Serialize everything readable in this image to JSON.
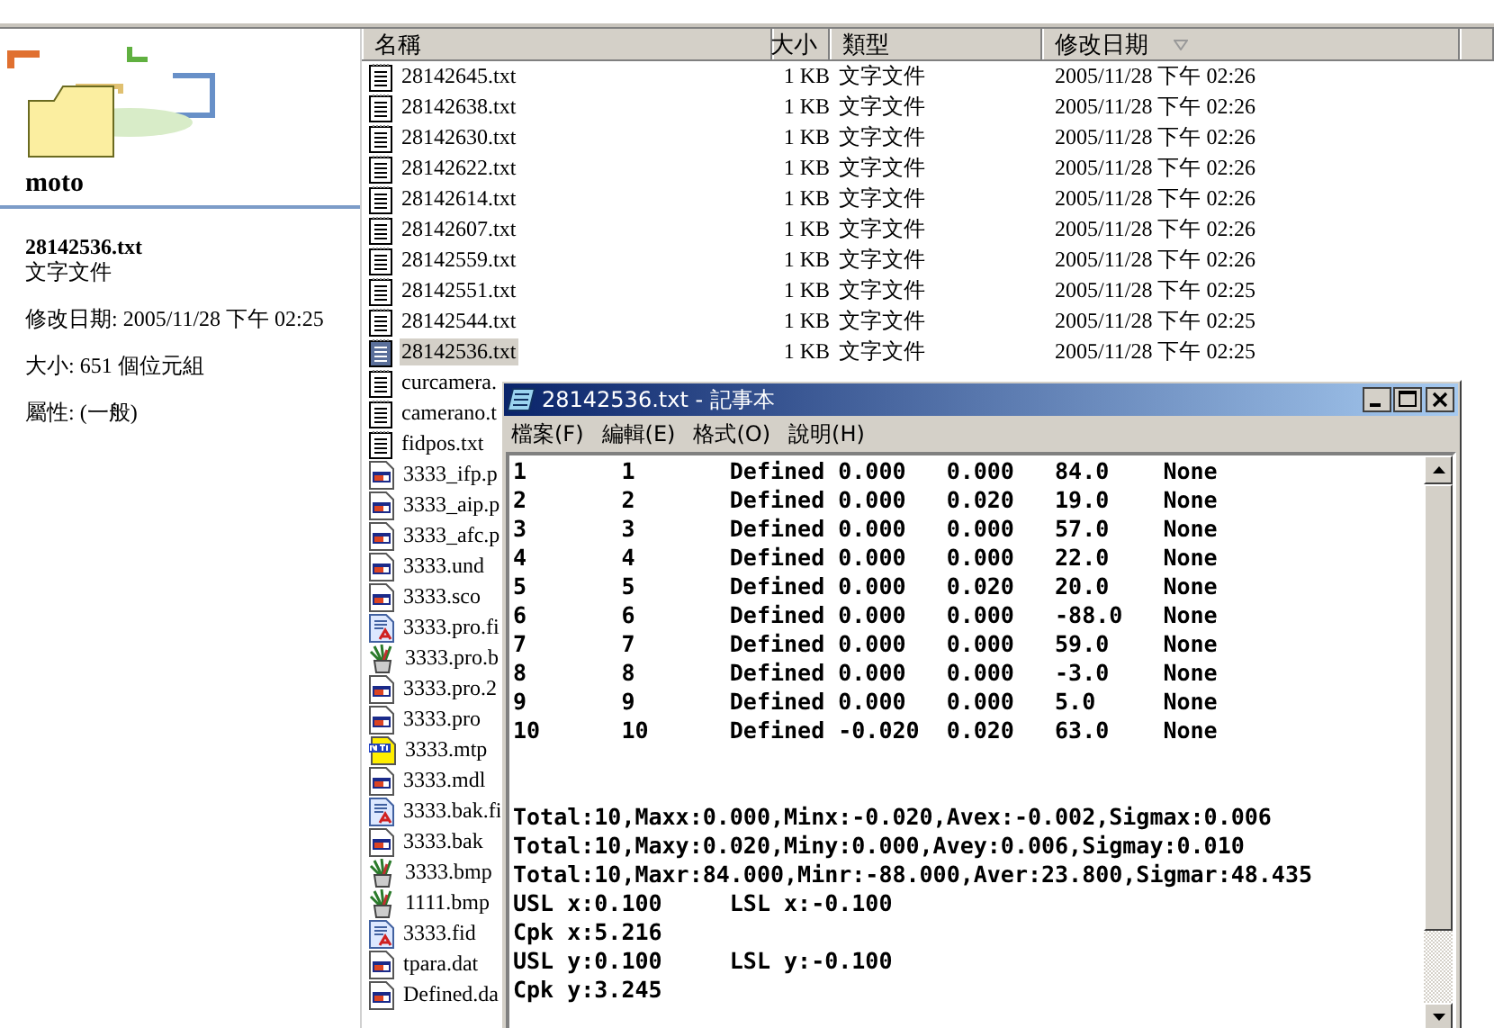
{
  "details_panel": {
    "folder_name": "moto",
    "file_name": "28142536.txt",
    "file_type": "文字文件",
    "modified": "修改日期: 2005/11/28 下午 02:25",
    "size": "大小: 651 個位元組",
    "attributes": "屬性: (一般)"
  },
  "file_list": {
    "columns": [
      {
        "label": "名稱",
        "sorted": false
      },
      {
        "label": "大小",
        "sorted": false
      },
      {
        "label": "類型",
        "sorted": false
      },
      {
        "label": "修改日期",
        "sorted": true
      }
    ],
    "rows": [
      {
        "kind": "text",
        "name": "28142645.txt",
        "size": "1 KB",
        "type": "文字文件",
        "modified": "2005/11/28 下午 02:26",
        "selected": false
      },
      {
        "kind": "text",
        "name": "28142638.txt",
        "size": "1 KB",
        "type": "文字文件",
        "modified": "2005/11/28 下午 02:26",
        "selected": false
      },
      {
        "kind": "text",
        "name": "28142630.txt",
        "size": "1 KB",
        "type": "文字文件",
        "modified": "2005/11/28 下午 02:26",
        "selected": false
      },
      {
        "kind": "text",
        "name": "28142622.txt",
        "size": "1 KB",
        "type": "文字文件",
        "modified": "2005/11/28 下午 02:26",
        "selected": false
      },
      {
        "kind": "text",
        "name": "28142614.txt",
        "size": "1 KB",
        "type": "文字文件",
        "modified": "2005/11/28 下午 02:26",
        "selected": false
      },
      {
        "kind": "text",
        "name": "28142607.txt",
        "size": "1 KB",
        "type": "文字文件",
        "modified": "2005/11/28 下午 02:26",
        "selected": false
      },
      {
        "kind": "text",
        "name": "28142559.txt",
        "size": "1 KB",
        "type": "文字文件",
        "modified": "2005/11/28 下午 02:26",
        "selected": false
      },
      {
        "kind": "text",
        "name": "28142551.txt",
        "size": "1 KB",
        "type": "文字文件",
        "modified": "2005/11/28 下午 02:25",
        "selected": false
      },
      {
        "kind": "text",
        "name": "28142544.txt",
        "size": "1 KB",
        "type": "文字文件",
        "modified": "2005/11/28 下午 02:25",
        "selected": false
      },
      {
        "kind": "text",
        "name": "28142536.txt",
        "size": "1 KB",
        "type": "文字文件",
        "modified": "2005/11/28 下午 02:25",
        "selected": true
      },
      {
        "kind": "text",
        "name": "curcamera.",
        "selected": false
      },
      {
        "kind": "text",
        "name": "camerano.t",
        "selected": false
      },
      {
        "kind": "text",
        "name": "fidpos.txt",
        "selected": false
      },
      {
        "kind": "app",
        "name": "3333_ifp.p",
        "selected": false
      },
      {
        "kind": "app",
        "name": "3333_aip.p",
        "selected": false
      },
      {
        "kind": "app",
        "name": "3333_afc.p",
        "selected": false
      },
      {
        "kind": "app",
        "name": "3333.und",
        "selected": false
      },
      {
        "kind": "app",
        "name": "3333.sco",
        "selected": false
      },
      {
        "kind": "wordpad",
        "name": "3333.pro.fi",
        "selected": false
      },
      {
        "kind": "paint",
        "name": "3333.pro.b",
        "selected": false
      },
      {
        "kind": "app",
        "name": "3333.pro.2",
        "selected": false
      },
      {
        "kind": "app",
        "name": "3333.pro",
        "selected": false
      },
      {
        "kind": "mtb",
        "name": "3333.mtp",
        "selected": false
      },
      {
        "kind": "app",
        "name": "3333.mdl",
        "selected": false
      },
      {
        "kind": "wordpad",
        "name": "3333.bak.fi",
        "selected": false
      },
      {
        "kind": "app",
        "name": "3333.bak",
        "selected": false
      },
      {
        "kind": "paint",
        "name": "3333.bmp",
        "selected": false
      },
      {
        "kind": "paint",
        "name": "1111.bmp",
        "selected": false
      },
      {
        "kind": "wordpad",
        "name": "3333.fid",
        "selected": false
      },
      {
        "kind": "app",
        "name": "tpara.dat",
        "selected": false
      },
      {
        "kind": "app",
        "name": "Defined.da",
        "selected": false
      }
    ]
  },
  "notepad": {
    "title": "28142536.txt - 記事本",
    "menu": [
      "檔案(F)",
      "編輯(E)",
      "格式(O)",
      "說明(H)"
    ],
    "lines": [
      "1       1       Defined 0.000   0.000   84.0    None",
      "2       2       Defined 0.000   0.020   19.0    None",
      "3       3       Defined 0.000   0.000   57.0    None",
      "4       4       Defined 0.000   0.000   22.0    None",
      "5       5       Defined 0.000   0.020   20.0    None",
      "6       6       Defined 0.000   0.000   -88.0   None",
      "7       7       Defined 0.000   0.000   59.0    None",
      "8       8       Defined 0.000   0.000   -3.0    None",
      "9       9       Defined 0.000   0.000   5.0     None",
      "10      10      Defined -0.020  0.020   63.0    None"
    ],
    "summary_lines": [
      "Total:10,Maxx:0.000,Minx:-0.020,Avex:-0.002,Sigmax:0.006",
      "Total:10,Maxy:0.020,Miny:0.000,Avey:0.006,Sigmay:0.010",
      "Total:10,Maxr:84.000,Minr:-88.000,Aver:23.800,Sigmar:48.435",
      "USL x:0.100     LSL x:-0.100",
      "Cpk x:5.216",
      "USL y:0.100     LSL y:-0.100",
      "Cpk y:3.245"
    ]
  }
}
